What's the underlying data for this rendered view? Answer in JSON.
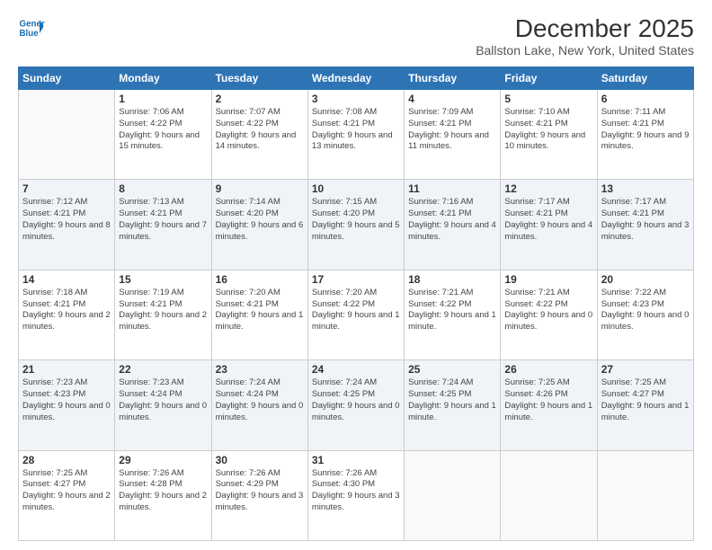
{
  "header": {
    "logo_line1": "General",
    "logo_line2": "Blue",
    "title": "December 2025",
    "subtitle": "Ballston Lake, New York, United States"
  },
  "weekdays": [
    "Sunday",
    "Monday",
    "Tuesday",
    "Wednesday",
    "Thursday",
    "Friday",
    "Saturday"
  ],
  "weeks": [
    [
      {
        "day": "",
        "sunrise": "",
        "sunset": "",
        "daylight": ""
      },
      {
        "day": "1",
        "sunrise": "Sunrise: 7:06 AM",
        "sunset": "Sunset: 4:22 PM",
        "daylight": "Daylight: 9 hours and 15 minutes."
      },
      {
        "day": "2",
        "sunrise": "Sunrise: 7:07 AM",
        "sunset": "Sunset: 4:22 PM",
        "daylight": "Daylight: 9 hours and 14 minutes."
      },
      {
        "day": "3",
        "sunrise": "Sunrise: 7:08 AM",
        "sunset": "Sunset: 4:21 PM",
        "daylight": "Daylight: 9 hours and 13 minutes."
      },
      {
        "day": "4",
        "sunrise": "Sunrise: 7:09 AM",
        "sunset": "Sunset: 4:21 PM",
        "daylight": "Daylight: 9 hours and 11 minutes."
      },
      {
        "day": "5",
        "sunrise": "Sunrise: 7:10 AM",
        "sunset": "Sunset: 4:21 PM",
        "daylight": "Daylight: 9 hours and 10 minutes."
      },
      {
        "day": "6",
        "sunrise": "Sunrise: 7:11 AM",
        "sunset": "Sunset: 4:21 PM",
        "daylight": "Daylight: 9 hours and 9 minutes."
      }
    ],
    [
      {
        "day": "7",
        "sunrise": "Sunrise: 7:12 AM",
        "sunset": "Sunset: 4:21 PM",
        "daylight": "Daylight: 9 hours and 8 minutes."
      },
      {
        "day": "8",
        "sunrise": "Sunrise: 7:13 AM",
        "sunset": "Sunset: 4:21 PM",
        "daylight": "Daylight: 9 hours and 7 minutes."
      },
      {
        "day": "9",
        "sunrise": "Sunrise: 7:14 AM",
        "sunset": "Sunset: 4:20 PM",
        "daylight": "Daylight: 9 hours and 6 minutes."
      },
      {
        "day": "10",
        "sunrise": "Sunrise: 7:15 AM",
        "sunset": "Sunset: 4:20 PM",
        "daylight": "Daylight: 9 hours and 5 minutes."
      },
      {
        "day": "11",
        "sunrise": "Sunrise: 7:16 AM",
        "sunset": "Sunset: 4:21 PM",
        "daylight": "Daylight: 9 hours and 4 minutes."
      },
      {
        "day": "12",
        "sunrise": "Sunrise: 7:17 AM",
        "sunset": "Sunset: 4:21 PM",
        "daylight": "Daylight: 9 hours and 4 minutes."
      },
      {
        "day": "13",
        "sunrise": "Sunrise: 7:17 AM",
        "sunset": "Sunset: 4:21 PM",
        "daylight": "Daylight: 9 hours and 3 minutes."
      }
    ],
    [
      {
        "day": "14",
        "sunrise": "Sunrise: 7:18 AM",
        "sunset": "Sunset: 4:21 PM",
        "daylight": "Daylight: 9 hours and 2 minutes."
      },
      {
        "day": "15",
        "sunrise": "Sunrise: 7:19 AM",
        "sunset": "Sunset: 4:21 PM",
        "daylight": "Daylight: 9 hours and 2 minutes."
      },
      {
        "day": "16",
        "sunrise": "Sunrise: 7:20 AM",
        "sunset": "Sunset: 4:21 PM",
        "daylight": "Daylight: 9 hours and 1 minute."
      },
      {
        "day": "17",
        "sunrise": "Sunrise: 7:20 AM",
        "sunset": "Sunset: 4:22 PM",
        "daylight": "Daylight: 9 hours and 1 minute."
      },
      {
        "day": "18",
        "sunrise": "Sunrise: 7:21 AM",
        "sunset": "Sunset: 4:22 PM",
        "daylight": "Daylight: 9 hours and 1 minute."
      },
      {
        "day": "19",
        "sunrise": "Sunrise: 7:21 AM",
        "sunset": "Sunset: 4:22 PM",
        "daylight": "Daylight: 9 hours and 0 minutes."
      },
      {
        "day": "20",
        "sunrise": "Sunrise: 7:22 AM",
        "sunset": "Sunset: 4:23 PM",
        "daylight": "Daylight: 9 hours and 0 minutes."
      }
    ],
    [
      {
        "day": "21",
        "sunrise": "Sunrise: 7:23 AM",
        "sunset": "Sunset: 4:23 PM",
        "daylight": "Daylight: 9 hours and 0 minutes."
      },
      {
        "day": "22",
        "sunrise": "Sunrise: 7:23 AM",
        "sunset": "Sunset: 4:24 PM",
        "daylight": "Daylight: 9 hours and 0 minutes."
      },
      {
        "day": "23",
        "sunrise": "Sunrise: 7:24 AM",
        "sunset": "Sunset: 4:24 PM",
        "daylight": "Daylight: 9 hours and 0 minutes."
      },
      {
        "day": "24",
        "sunrise": "Sunrise: 7:24 AM",
        "sunset": "Sunset: 4:25 PM",
        "daylight": "Daylight: 9 hours and 0 minutes."
      },
      {
        "day": "25",
        "sunrise": "Sunrise: 7:24 AM",
        "sunset": "Sunset: 4:25 PM",
        "daylight": "Daylight: 9 hours and 1 minute."
      },
      {
        "day": "26",
        "sunrise": "Sunrise: 7:25 AM",
        "sunset": "Sunset: 4:26 PM",
        "daylight": "Daylight: 9 hours and 1 minute."
      },
      {
        "day": "27",
        "sunrise": "Sunrise: 7:25 AM",
        "sunset": "Sunset: 4:27 PM",
        "daylight": "Daylight: 9 hours and 1 minute."
      }
    ],
    [
      {
        "day": "28",
        "sunrise": "Sunrise: 7:25 AM",
        "sunset": "Sunset: 4:27 PM",
        "daylight": "Daylight: 9 hours and 2 minutes."
      },
      {
        "day": "29",
        "sunrise": "Sunrise: 7:26 AM",
        "sunset": "Sunset: 4:28 PM",
        "daylight": "Daylight: 9 hours and 2 minutes."
      },
      {
        "day": "30",
        "sunrise": "Sunrise: 7:26 AM",
        "sunset": "Sunset: 4:29 PM",
        "daylight": "Daylight: 9 hours and 3 minutes."
      },
      {
        "day": "31",
        "sunrise": "Sunrise: 7:26 AM",
        "sunset": "Sunset: 4:30 PM",
        "daylight": "Daylight: 9 hours and 3 minutes."
      },
      {
        "day": "",
        "sunrise": "",
        "sunset": "",
        "daylight": ""
      },
      {
        "day": "",
        "sunrise": "",
        "sunset": "",
        "daylight": ""
      },
      {
        "day": "",
        "sunrise": "",
        "sunset": "",
        "daylight": ""
      }
    ]
  ]
}
